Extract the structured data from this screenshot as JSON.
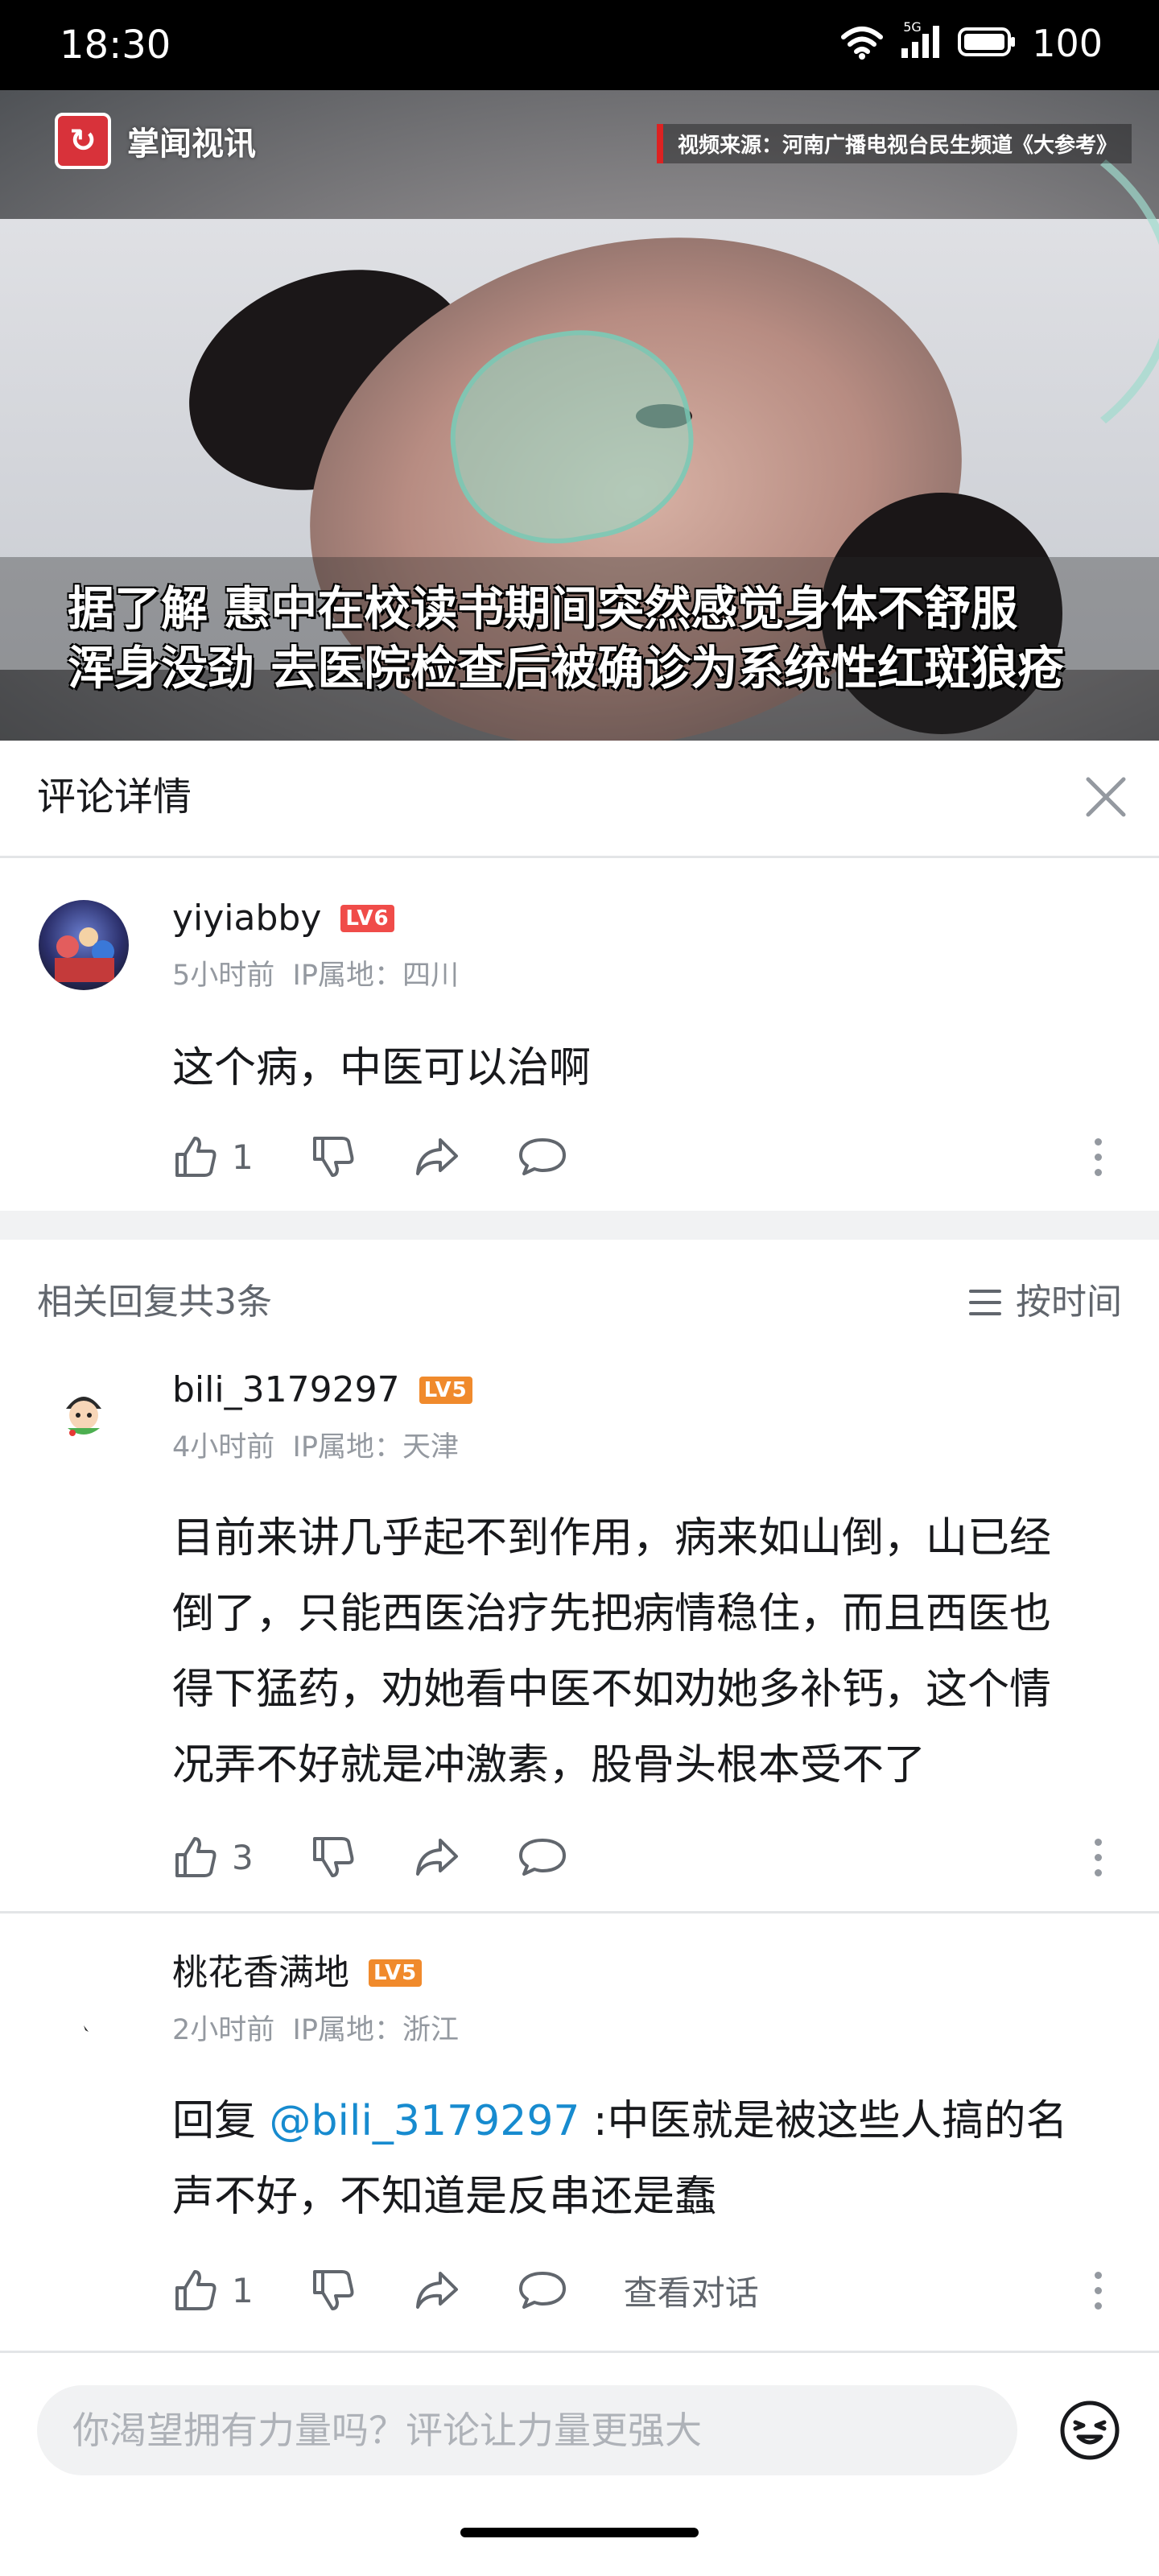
{
  "status_bar": {
    "time": "18:30",
    "network": "5G",
    "battery": "100",
    "icons": [
      "wifi-icon",
      "signal-icon",
      "battery-icon"
    ]
  },
  "video": {
    "logo_text": "掌闻视讯",
    "source_text": "视频来源：河南广播电视台民生频道《大参考》",
    "subtitle_line1": "据了解 惠中在校读书期间突然感觉身体不舒服",
    "subtitle_line2": "浑身没劲 去医院检查后被确诊为系统性红斑狼疮",
    "progress_fraction": 0.23
  },
  "detail_header": {
    "title": "评论详情",
    "close_icon": "close-icon"
  },
  "main_comment": {
    "username": "yiyiabby",
    "level": "LV6",
    "time": "5小时前",
    "ip": "IP属地：四川",
    "text": "这个病，中医可以治啊",
    "likes": "1"
  },
  "replies_header": {
    "count_label": "相关回复共3条",
    "sort_label": "按时间"
  },
  "replies": [
    {
      "username": "bili_3179297",
      "level": "LV5",
      "time": "4小时前",
      "ip": "IP属地：天津",
      "text_line1": "目前来讲几乎起不到作用，病来如山倒，山已经",
      "text_line2": "倒了，只能西医治疗先把病情稳住，而且西医也",
      "text_line3": "得下猛药，劝她看中医不如劝她多补钙，这个情",
      "text_line4": "况弄不好就是冲激素，股骨头根本受不了",
      "likes": "3"
    },
    {
      "username": "桃花香满地",
      "level": "LV5",
      "time": "2小时前",
      "ip": "IP属地：浙江",
      "reply_prefix": "回复",
      "mention": "@bili_3179297",
      "text_line1": " :中医就是被这些人搞的名",
      "text_line2": "声不好，不知道是反串还是蠢",
      "likes": "1",
      "view_conversation": "查看对话"
    }
  ],
  "input_bar": {
    "placeholder": "你渴望拥有力量吗？评论让力量更强大",
    "emoji_icon": "emoji-icon"
  },
  "colors": {
    "accent_pink": "#fb7299",
    "link_blue": "#178bcf",
    "lv6": "#f04c49",
    "lv5": "#f08a2c"
  }
}
